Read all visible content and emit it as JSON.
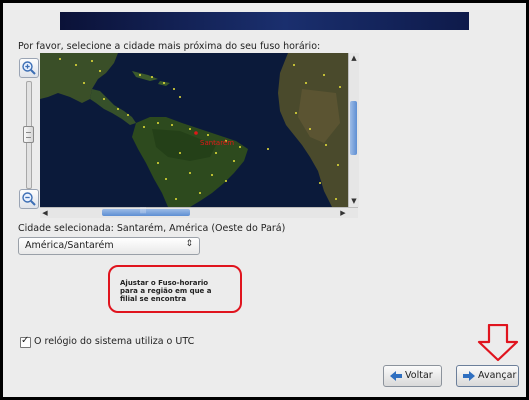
{
  "prompt": "Por favor, selecione a cidade mais próxima do seu fuso horário:",
  "zoom": {
    "in_icon": "zoom-in-icon",
    "out_icon": "zoom-out-icon"
  },
  "map": {
    "selected_marker_label": "Santarém",
    "colors": {
      "ocean": "#0b1a3a",
      "land": "#2d4a1e",
      "city_dot": "#e8e23a",
      "selected": "#e01818"
    }
  },
  "scroll": {
    "h_thumb_icon": "grip-icon"
  },
  "selected_city": "Cidade selecionada: Santarém, América (Oeste do Pará)",
  "timezone_select": {
    "value": "América/Santarém"
  },
  "annotation": {
    "text": "Ajustar o Fuso-horario para a região em que a filial se encontra",
    "color": "#e0141e"
  },
  "utc_checkbox": {
    "label": "O relógio do sistema utiliza o UTC",
    "checked": true
  },
  "buttons": {
    "back": "Voltar",
    "next": "Avançar"
  },
  "accent_color": "#2f6fc0"
}
